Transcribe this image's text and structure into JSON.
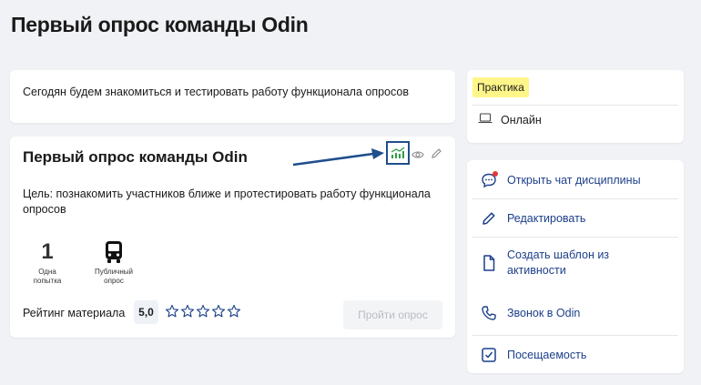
{
  "page": {
    "title": "Первый опрос команды Odin"
  },
  "description": {
    "text": "Сегодян будем знакомиться и тестировать работу функционала опросов"
  },
  "quiz": {
    "title": "Первый опрос команды Odin",
    "goal": "Цель: познакомить участников ближе и протестировать работу функционала опросов",
    "attempts_count": "1",
    "attempts_label_line1": "Одна",
    "attempts_label_line2": "попытка",
    "public_label_line1": "Публичный",
    "public_label_line2": "опрос",
    "rating_label": "Рейтинг материала",
    "rating_value": "5,0",
    "rating_stars_filled": 0,
    "rating_stars_total": 5,
    "take_button": "Пройти опрос",
    "icons": [
      "analytics-icon",
      "eye-icon",
      "pencil-icon",
      "bus-icon",
      "star-icon"
    ]
  },
  "info": {
    "tag": "Практика",
    "format": "Онлайн",
    "tag_color": "#fff68a"
  },
  "actions": [
    {
      "label": "Открыть чат дисциплины",
      "icon": "chat-icon"
    },
    {
      "label": "Редактировать",
      "icon": "pencil-icon"
    },
    {
      "label_line1": "Создать шаблон из",
      "label_line2": "активности",
      "icon": "file-icon"
    },
    {
      "label": "Звонок в Odin",
      "icon": "phone-icon"
    },
    {
      "label": "Посещаемость",
      "icon": "checkbox-icon"
    }
  ],
  "colors": {
    "accent": "#1c3f8a",
    "highlight_box": "#1f4e8c",
    "analytics_green": "#2e9e48",
    "notification": "#e53935"
  }
}
